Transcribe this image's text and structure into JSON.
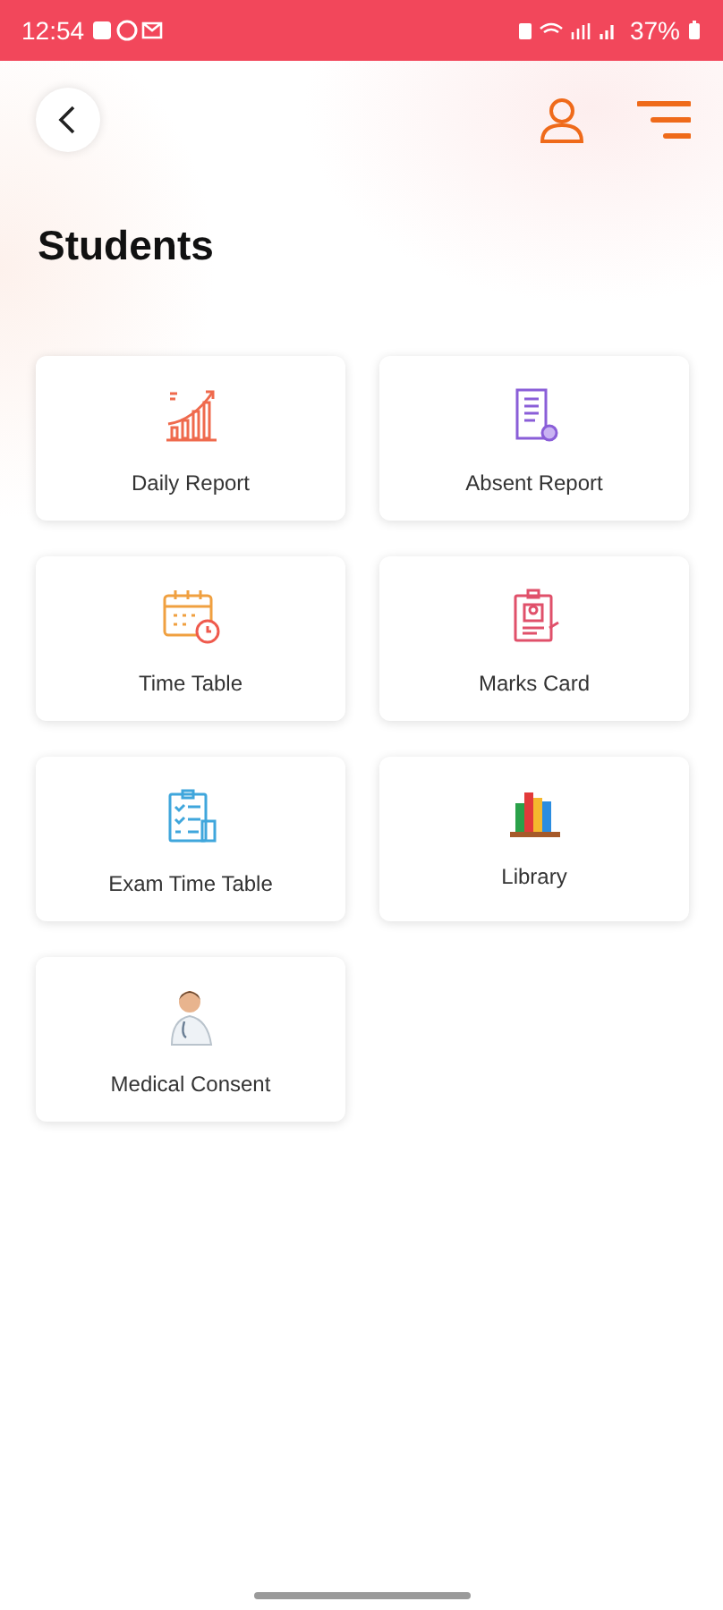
{
  "status_bar": {
    "time": "12:54",
    "battery": "37%"
  },
  "title": "Students",
  "tiles": [
    {
      "label": "Daily Report",
      "kind": "chart"
    },
    {
      "label": "Absent Report",
      "kind": "document"
    },
    {
      "label": "Time Table",
      "kind": "calendar"
    },
    {
      "label": "Marks Card",
      "kind": "id-card"
    },
    {
      "label": "Exam Time Table",
      "kind": "checklist"
    },
    {
      "label": "Library",
      "kind": "books"
    },
    {
      "label": "Medical Consent",
      "kind": "doctor"
    }
  ]
}
